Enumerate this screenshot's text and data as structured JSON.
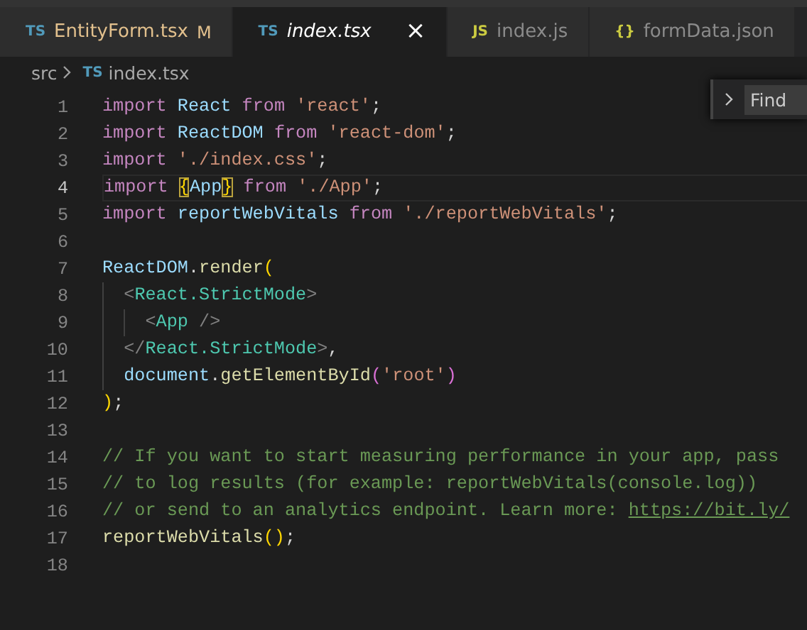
{
  "tabs": [
    {
      "kind": "ts",
      "icon": "TS",
      "label": "EntityForm.tsx",
      "modified": true,
      "mark": "M",
      "selected": false,
      "preview": false
    },
    {
      "kind": "ts",
      "icon": "TS",
      "label": "index.tsx",
      "modified": false,
      "selected": true,
      "preview": true,
      "close": "×"
    },
    {
      "kind": "js",
      "icon": "JS",
      "label": "index.js",
      "modified": false,
      "selected": false,
      "preview": false
    },
    {
      "kind": "json",
      "icon": "{}",
      "label": "formData.json",
      "modified": false,
      "selected": false,
      "preview": false
    }
  ],
  "breadcrumb": {
    "folder": "src",
    "file_icon": "TS",
    "file": "index.tsx"
  },
  "find_widget": {
    "label": "Find",
    "expanded": false
  },
  "lines": [
    {
      "number": "1",
      "current": false,
      "tokens": [
        {
          "kind": "kw",
          "text": "import "
        },
        {
          "kind": "var",
          "text": "React "
        },
        {
          "kind": "kw",
          "text": "from "
        },
        {
          "kind": "str",
          "text": "'react'"
        },
        {
          "kind": "punct",
          "text": ";"
        }
      ]
    },
    {
      "number": "2",
      "current": false,
      "tokens": [
        {
          "kind": "kw",
          "text": "import "
        },
        {
          "kind": "var",
          "text": "ReactDOM "
        },
        {
          "kind": "kw",
          "text": "from "
        },
        {
          "kind": "str",
          "text": "'react-dom'"
        },
        {
          "kind": "punct",
          "text": ";"
        }
      ]
    },
    {
      "number": "3",
      "current": false,
      "tokens": [
        {
          "kind": "kw",
          "text": "import "
        },
        {
          "kind": "str",
          "text": "'./index.css'"
        },
        {
          "kind": "punct",
          "text": ";"
        }
      ]
    },
    {
      "number": "4",
      "current": true,
      "tokens": [
        {
          "kind": "kw",
          "text": "import "
        },
        {
          "kind": "match",
          "text": "{"
        },
        {
          "kind": "var",
          "text": "App"
        },
        {
          "kind": "match",
          "text": "}"
        },
        {
          "kind": "kw",
          "text": " from "
        },
        {
          "kind": "str",
          "text": "'./App'"
        },
        {
          "kind": "punct",
          "text": ";"
        }
      ]
    },
    {
      "number": "5",
      "current": false,
      "tokens": [
        {
          "kind": "kw",
          "text": "import "
        },
        {
          "kind": "var",
          "text": "reportWebVitals "
        },
        {
          "kind": "kw",
          "text": "from "
        },
        {
          "kind": "str",
          "text": "'./reportWebVitals'"
        },
        {
          "kind": "punct",
          "text": ";"
        }
      ]
    },
    {
      "number": "6",
      "current": false
    },
    {
      "number": "7",
      "current": false,
      "tokens": [
        {
          "kind": "var",
          "text": "ReactDOM"
        },
        {
          "kind": "punct",
          "text": "."
        },
        {
          "kind": "fn",
          "text": "render"
        },
        {
          "kind": "br1",
          "text": "("
        }
      ]
    },
    {
      "number": "8",
      "current": false,
      "tokens": [
        {
          "kind": "tagp",
          "text": "  <"
        },
        {
          "kind": "tag",
          "text": "React.StrictMode"
        },
        {
          "kind": "tagp",
          "text": ">"
        }
      ]
    },
    {
      "number": "9",
      "current": false,
      "tokens": [
        {
          "kind": "tagp",
          "text": "    <"
        },
        {
          "kind": "tag",
          "text": "App"
        },
        {
          "kind": "tagp",
          "text": " />"
        }
      ]
    },
    {
      "number": "10",
      "current": false,
      "tokens": [
        {
          "kind": "tagp",
          "text": "  </"
        },
        {
          "kind": "tag",
          "text": "React.StrictMode"
        },
        {
          "kind": "tagp",
          "text": ">"
        },
        {
          "kind": "punct",
          "text": ","
        }
      ]
    },
    {
      "number": "11",
      "current": false,
      "tokens": [
        {
          "kind": "var",
          "text": "  document"
        },
        {
          "kind": "punct",
          "text": "."
        },
        {
          "kind": "fn",
          "text": "getElementById"
        },
        {
          "kind": "br2",
          "text": "("
        },
        {
          "kind": "str",
          "text": "'root'"
        },
        {
          "kind": "br2",
          "text": ")"
        }
      ]
    },
    {
      "number": "12",
      "current": false,
      "tokens": [
        {
          "kind": "br1",
          "text": ")"
        },
        {
          "kind": "punct",
          "text": ";"
        }
      ]
    },
    {
      "number": "13",
      "current": false
    },
    {
      "number": "14",
      "current": false,
      "tokens": [
        {
          "kind": "comment",
          "text": "// If you want to start measuring performance in your app, pass"
        }
      ]
    },
    {
      "number": "15",
      "current": false,
      "tokens": [
        {
          "kind": "comment",
          "text": "// to log results (for example: reportWebVitals(console.log))"
        }
      ]
    },
    {
      "number": "16",
      "current": false,
      "tokens": [
        {
          "kind": "comment",
          "text": "// or send to an analytics endpoint. Learn more: "
        },
        {
          "kind": "link",
          "text": "https://bit.ly/"
        }
      ]
    },
    {
      "number": "17",
      "current": false,
      "tokens": [
        {
          "kind": "fn",
          "text": "reportWebVitals"
        },
        {
          "kind": "br1",
          "text": "()"
        },
        {
          "kind": "punct",
          "text": ";"
        }
      ]
    },
    {
      "number": "18",
      "current": false
    }
  ]
}
